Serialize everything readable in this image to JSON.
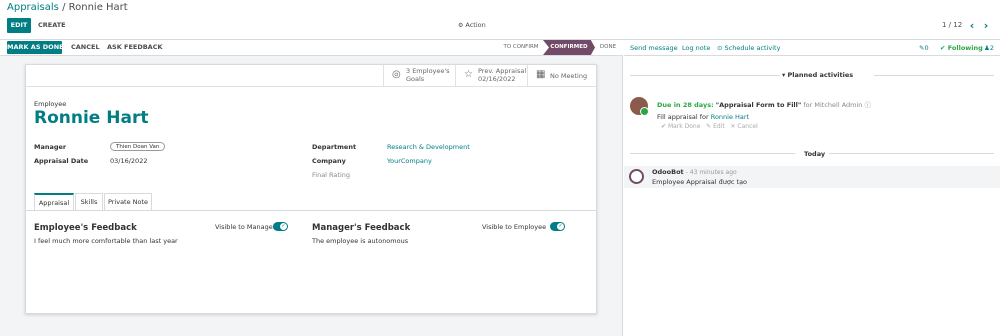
{
  "breadcrumb": {
    "parent": "Appraisals",
    "separator": " / ",
    "current": "Ronnie Hart"
  },
  "toolbar": {
    "edit": "EDIT",
    "create": "CREATE",
    "action": "Action",
    "pager": "1 / 12"
  },
  "statusbar": {
    "buttons": [
      "MARK AS DONE",
      "CANCEL",
      "ASK FEEDBACK"
    ],
    "stages": [
      "TO CONFIRM",
      "CONFIRMED",
      "DONE"
    ],
    "active_stage": "CONFIRMED"
  },
  "smart_buttons": {
    "goals_count": "3 Employee's",
    "goals_label": "Goals",
    "prev_label": "Prev. Appraisal",
    "prev_date": "02/16/2022",
    "meeting": "No Meeting"
  },
  "employee": {
    "label": "Employee",
    "name": "Ronnie Hart",
    "manager_label": "Manager",
    "manager": "Thien Doan Van",
    "date_label": "Appraisal Date",
    "date": "03/16/2022",
    "department_label": "Department",
    "department": "Research & Development",
    "company_label": "Company",
    "company": "YourCompany",
    "final_rating_label": "Final Rating"
  },
  "tabs": [
    "Appraisal",
    "Skills",
    "Private Note"
  ],
  "feedback": {
    "employee_title": "Employee's Feedback",
    "employee_visible": "Visible to Manager",
    "employee_text": "I feel much more comfortable than last year",
    "manager_title": "Manager's Feedback",
    "manager_visible": "Visible to Employee",
    "manager_text": "The employee is autonomous"
  },
  "chatter": {
    "send_message": "Send message",
    "log_note": "Log note",
    "schedule": "Schedule activity",
    "attachments": "0",
    "following": "Following",
    "followers": "2",
    "planned": "Planned activities",
    "activity_due": "Due in 28 days:",
    "activity_title": "\"Appraisal Form to Fill\"",
    "activity_for": "for Mitchell Admin",
    "activity_desc_prefix": "Fill appraisal for",
    "activity_desc_link": "Ronnie Hart",
    "mark_done": "Mark Done",
    "edit": "Edit",
    "cancel": "Cancel",
    "today": "Today",
    "msg_author": "OdooBot",
    "msg_time": "- 43 minutes ago",
    "msg_body": "Employee Appraisal được tạo"
  },
  "colors": {
    "accent": "#017e84",
    "stage_active": "#714b67",
    "green": "#28a745",
    "background": "#f3f4f6"
  }
}
